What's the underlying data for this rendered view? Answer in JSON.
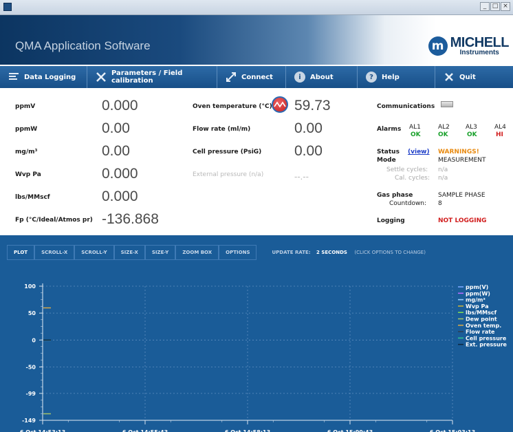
{
  "window": {
    "minimize": "_",
    "maximize": "□",
    "close": "×"
  },
  "header": {
    "title": "QMA Application Software",
    "logo_mark": "m",
    "logo_main": "MICHELL",
    "logo_sub": "Instruments"
  },
  "nav": [
    {
      "label": "Data Logging",
      "icon": "data-logging-icon"
    },
    {
      "label": "Parameters / Field calibration",
      "icon": "tools-icon"
    },
    {
      "label": "Connect",
      "icon": "connect-icon"
    },
    {
      "label": "About",
      "icon": "info-icon"
    },
    {
      "label": "Help",
      "icon": "help-icon"
    },
    {
      "label": "Quit",
      "icon": "quit-icon"
    }
  ],
  "readings": {
    "ppmv": {
      "label": "ppmV",
      "value": "0.000"
    },
    "ppmw": {
      "label": "ppmW",
      "value": "0.00"
    },
    "mgm3": {
      "label": "mg/m³",
      "value": "0.00"
    },
    "wvp": {
      "label": "Wvp Pa",
      "value": "0.000"
    },
    "lbs": {
      "label": "lbs/MMscf",
      "value": "0.000"
    },
    "fp": {
      "label": "Fp (°C/Ideal/Atmos pr)",
      "value": "-136.868"
    },
    "oven": {
      "label": "Oven temperature (°C)",
      "value": "59.73"
    },
    "flow": {
      "label": "Flow rate (ml/m)",
      "value": "0.00"
    },
    "cell": {
      "label": "Cell pressure (PsiG)",
      "value": "0.00"
    },
    "ext": {
      "label": "External pressure (n/a)",
      "value": "--.--"
    }
  },
  "status": {
    "communications_label": "Communications",
    "alarms_label": "Alarms",
    "alarms": [
      {
        "name": "AL1",
        "state": "OK"
      },
      {
        "name": "AL2",
        "state": "OK"
      },
      {
        "name": "AL3",
        "state": "OK"
      },
      {
        "name": "AL4",
        "state": "HI"
      }
    ],
    "status_label": "Status",
    "view_link": "(view)",
    "status_value": "WARNINGS!",
    "mode_label": "Mode",
    "mode_value": "MEASUREMENT",
    "settle_label": "Settle cycles:",
    "settle_value": "n/a",
    "cal_label": "Cal. cycles:",
    "cal_value": "n/a",
    "gas_label": "Gas phase",
    "gas_value": "SAMPLE PHASE",
    "countdown_label": "Countdown:",
    "countdown_value": "8",
    "logging_label": "Logging",
    "logging_value": "NOT LOGGING"
  },
  "plot_toolbar": {
    "tabs": [
      "PLOT",
      "SCROLL-X",
      "SCROLL-Y",
      "SIZE-X",
      "SIZE-Y",
      "ZOOM BOX",
      "OPTIONS"
    ],
    "update_label": "UPDATE RATE:",
    "update_value": "2 SECONDS",
    "update_hint": "(CLICK OPTIONS TO CHANGE)"
  },
  "colors": {
    "plot_bg": "#1a5c98",
    "ok": "#18a02a",
    "hi": "#d11d1d",
    "warning": "#e88a10"
  },
  "chart_data": {
    "type": "line",
    "y_ticks": [
      100,
      50,
      0,
      -50,
      -99,
      -149
    ],
    "ylim": [
      -149,
      100
    ],
    "x_ticks": [
      "6 Oct 14:53:13",
      "6 Oct 14:55:43",
      "6 Oct 14:58:13",
      "6 Oct 15:00:43",
      "6 Oct 15:03:13"
    ],
    "grid": true,
    "legend_position": "right",
    "series": [
      {
        "name": "ppm(V)",
        "color": "#7aa6ff",
        "values": [
          0.0
        ]
      },
      {
        "name": "ppm(W)",
        "color": "#b56cff",
        "values": [
          0.0
        ]
      },
      {
        "name": "mg/m³",
        "color": "#9ad0ff",
        "values": [
          0.0
        ]
      },
      {
        "name": "Wvp Pa",
        "color": "#c7b23a",
        "values": [
          0.0
        ]
      },
      {
        "name": "lbs/MMscf",
        "color": "#7ed957",
        "values": [
          0.0
        ]
      },
      {
        "name": "Dew point",
        "color": "#a3c26a",
        "values": [
          -136.868
        ]
      },
      {
        "name": "Oven temp.",
        "color": "#d4a84a",
        "values": [
          59.73
        ]
      },
      {
        "name": "Flow rate",
        "color": "#2b3f56",
        "values": [
          0.0
        ]
      },
      {
        "name": "Cell pressure",
        "color": "#2fc28f",
        "values": [
          0.0
        ]
      },
      {
        "name": "Ext. pressure",
        "color": "#0d2a44",
        "values": [
          0.0
        ]
      }
    ]
  }
}
